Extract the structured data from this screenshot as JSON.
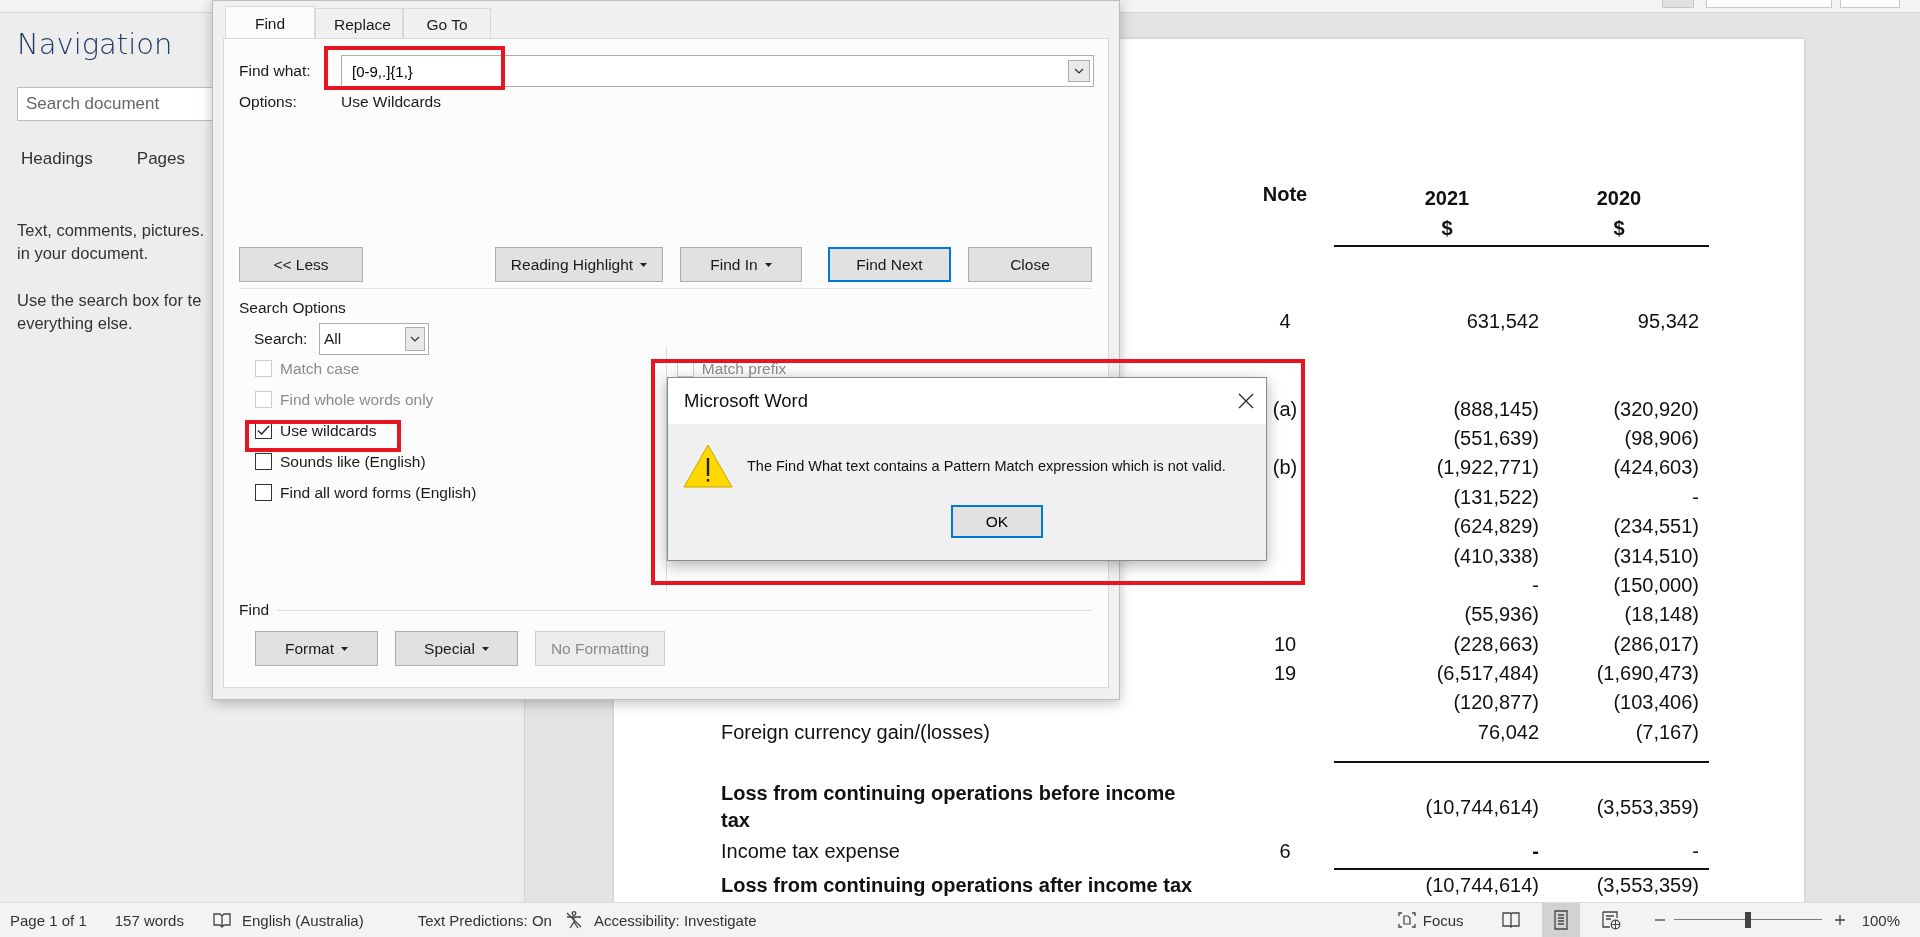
{
  "navigation": {
    "title": "Navigation",
    "search": {
      "placeholder": "Search document"
    },
    "tabs": [
      {
        "label": "Headings",
        "selected": false
      },
      {
        "label": "Pages",
        "selected": false
      }
    ],
    "paragraphs": [
      "Text, comments, pictures.",
      "in your document.",
      "Use the search box for te",
      "everything else."
    ]
  },
  "document": {
    "table": {
      "columns": [
        {
          "label": "Note"
        },
        {
          "label": "2021",
          "unit": "$"
        },
        {
          "label": "2020",
          "unit": "$"
        }
      ],
      "sections": [
        {
          "rows": [
            {
              "label": "",
              "note": "4",
              "values": [
                "631,542",
                "95,342"
              ]
            }
          ]
        },
        {
          "rows": [
            {
              "label": "",
              "note": "(a)",
              "values": [
                "(888,145)",
                "(320,920)"
              ]
            },
            {
              "label": "",
              "note": "",
              "values": [
                "(551,639)",
                "(98,906)"
              ]
            },
            {
              "label": "",
              "note": "(b)",
              "values": [
                "(1,922,771)",
                "(424,603)"
              ]
            },
            {
              "label": "",
              "note": "",
              "values": [
                "(131,522)",
                "-"
              ]
            },
            {
              "label": "",
              "note": "",
              "values": [
                "(624,829)",
                "(234,551)"
              ]
            },
            {
              "label": "",
              "note": "",
              "values": [
                "(410,338)",
                "(314,510)"
              ]
            },
            {
              "label": "",
              "note": "",
              "values": [
                "-",
                "(150,000)"
              ]
            },
            {
              "label": "",
              "note": "",
              "values": [
                "(55,936)",
                "(18,148)"
              ]
            },
            {
              "label": "",
              "note": "10",
              "values": [
                "(228,663)",
                "(286,017)"
              ]
            },
            {
              "label": "",
              "note": "19",
              "values": [
                "(6,517,484)",
                "(1,690,473)"
              ]
            },
            {
              "label": "",
              "note": "",
              "values": [
                "(120,877)",
                "(103,406)"
              ]
            },
            {
              "label": "Foreign currency gain/(losses)",
              "note": "",
              "values": [
                "76,042",
                "(7,167)"
              ]
            }
          ]
        },
        {
          "rows": [
            {
              "label": "Loss from continuing operations before income tax",
              "note": "",
              "values": [
                "(10,744,614)",
                "(3,553,359)"
              ],
              "bold": true,
              "rule_above": true
            },
            {
              "label": "Income tax expense",
              "note": "6",
              "values": [
                "-",
                "-"
              ],
              "bold_values": [
                true,
                false
              ]
            },
            {
              "label": "Loss from continuing operations after income tax",
              "note": "",
              "values": [
                "(10,744,614)",
                "(3,553,359)"
              ],
              "bold": true,
              "rule_above": true
            }
          ]
        }
      ]
    }
  },
  "find_dialog": {
    "tabs": [
      {
        "label": "Find",
        "selected": true
      },
      {
        "label": "Replace",
        "selected": false
      },
      {
        "label": "Go To",
        "selected": false
      }
    ],
    "find_what": {
      "label": "Find what:",
      "value": "[0-9,.]{1,}"
    },
    "options": {
      "label": "Options:",
      "value": "Use Wildcards"
    },
    "buttons": [
      {
        "label": "<< Less",
        "dropdown": false,
        "default": false
      },
      {
        "label": "Reading Highlight",
        "dropdown": true,
        "default": false
      },
      {
        "label": "Find In",
        "dropdown": true,
        "default": false
      },
      {
        "label": "Find Next",
        "dropdown": false,
        "default": true
      },
      {
        "label": "Close",
        "dropdown": false,
        "default": false
      }
    ],
    "search_options": {
      "title": "Search Options",
      "search_label": "Search:",
      "search_value": "All",
      "checkboxes": [
        {
          "label": "Match case",
          "checked": false,
          "disabled": true
        },
        {
          "label": "Find whole words only",
          "checked": false,
          "disabled": true
        },
        {
          "label": "Use wildcards",
          "checked": true,
          "disabled": false
        },
        {
          "label": "Sounds like (English)",
          "checked": false,
          "disabled": false
        },
        {
          "label": "Find all word forms (English)",
          "checked": false,
          "disabled": false
        }
      ],
      "right_checkboxes": [
        {
          "label": "Match prefix",
          "checked": false,
          "disabled": true
        }
      ]
    },
    "find_section": {
      "title": "Find",
      "buttons": [
        {
          "label": "Format",
          "dropdown": true,
          "disabled": false
        },
        {
          "label": "Special",
          "dropdown": true,
          "disabled": false
        },
        {
          "label": "No Formatting",
          "dropdown": false,
          "disabled": true
        }
      ]
    }
  },
  "message_box": {
    "title": "Microsoft Word",
    "message": "The Find What text contains a Pattern Match expression which is not valid.",
    "button": "OK"
  },
  "status_bar": {
    "page": "Page 1 of 1",
    "words": "157 words",
    "language": "English (Australia)",
    "text_predictions": "Text Predictions: On",
    "accessibility": "Accessibility: Investigate",
    "focus": "Focus",
    "views": [
      {
        "kind": "read",
        "selected": false
      },
      {
        "kind": "print",
        "selected": true
      },
      {
        "kind": "web",
        "selected": false
      }
    ],
    "zoom": {
      "level": 0.5,
      "value": "100%"
    }
  }
}
